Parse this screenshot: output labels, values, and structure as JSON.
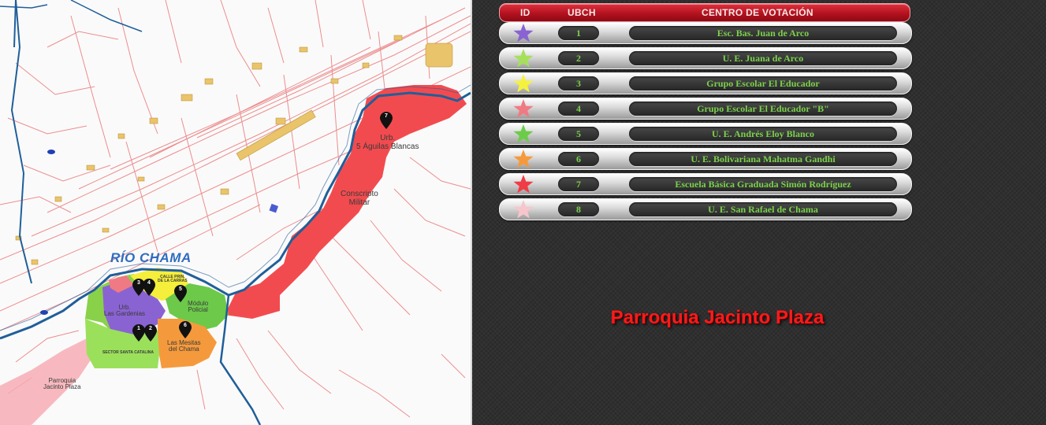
{
  "map": {
    "river_label": "RÍO CHAMA",
    "labels": {
      "urb_aguilas": "Urb.\n5 Águilas Blancas",
      "conscripto": "Conscripto\nMilitar",
      "calle": "CALLE PRIN.\nDE LA CARRAS",
      "modulo": "Módulo\nPolicial",
      "urb_gardenias": "Urb.\nLas Gardenias",
      "mesitas": "Las Mesitas\ndel Chama",
      "sector": "SECTOR SANTA CATALINA",
      "parroquia": "Parroquia\nJacinto Plaza"
    },
    "pins": [
      "7",
      "3",
      "4",
      "5",
      "1",
      "2",
      "6"
    ]
  },
  "table": {
    "headers": {
      "id": "ID",
      "ubch": "UBCH",
      "centro": "CENTRO DE VOTACIÓN"
    },
    "rows": [
      {
        "ubch": "1",
        "centro": "Esc. Bas. Juan de Arco",
        "star_color": "#8a63d2"
      },
      {
        "ubch": "2",
        "centro": "U. E. Juana de Arco",
        "star_color": "#a6e05a"
      },
      {
        "ubch": "3",
        "centro": "Grupo Escolar El Educador",
        "star_color": "#f5f23c"
      },
      {
        "ubch": "4",
        "centro": "Grupo Escolar El Educador \"B\"",
        "star_color": "#f07a84"
      },
      {
        "ubch": "5",
        "centro": "U. E. Andrés Eloy Blanco",
        "star_color": "#6ccc4a"
      },
      {
        "ubch": "6",
        "centro": "U. E. Bolivariana Mahatma Gandhi",
        "star_color": "#f59a3c"
      },
      {
        "ubch": "7",
        "centro": "Escuela Básica Graduada Simón Rodríguez",
        "star_color": "#f03c46"
      },
      {
        "ubch": "8",
        "centro": "U. E. San Rafael de Chama",
        "star_color": "#f6c6cc"
      }
    ]
  },
  "title": "Parroquia Jacinto Plaza",
  "colors": {
    "header_red": "#c41b28",
    "text_green": "#7bd14c",
    "title_red": "#ff1a1a",
    "river_blue": "#1f5f9a",
    "road_red": "#e6686a"
  }
}
